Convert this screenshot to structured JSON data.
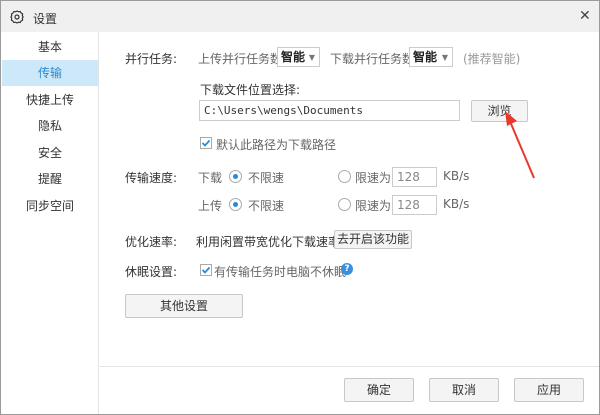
{
  "window": {
    "title": "设置",
    "close": "✕"
  },
  "sidebar": {
    "items": [
      {
        "label": "基本"
      },
      {
        "label": "传输",
        "active": true
      },
      {
        "label": "快捷上传"
      },
      {
        "label": "隐私"
      },
      {
        "label": "安全"
      },
      {
        "label": "提醒"
      },
      {
        "label": "同步空间"
      }
    ]
  },
  "parallel": {
    "label": "并行任务:",
    "upload_label": "上传并行任务数",
    "upload_value": "智能",
    "download_label": "下载并行任务数",
    "download_value": "智能",
    "hint": "(推荐智能)"
  },
  "download_path": {
    "label": "下载文件位置选择:",
    "value": "C:\\Users\\wengs\\Documents",
    "browse": "浏览",
    "default_checkbox": "默认此路径为下载路径",
    "default_checked": true
  },
  "speed": {
    "label": "传输速度:",
    "download_label": "下载",
    "upload_label": "上传",
    "unlimited": "不限速",
    "limit": "限速为",
    "download_limit": "128",
    "upload_limit": "128",
    "unit": "KB/s"
  },
  "optimize": {
    "label": "优化速率:",
    "text": "利用闲置带宽优化下载速率",
    "button": "去开启该功能"
  },
  "sleep": {
    "label": "休眠设置:",
    "checkbox": "有传输任务时电脑不休眠",
    "checked": true,
    "help": "?"
  },
  "other_button": "其他设置",
  "footer": {
    "ok": "确定",
    "cancel": "取消",
    "apply": "应用"
  },
  "colors": {
    "accent": "#2a8ad4",
    "active_bg": "#cde8f8",
    "arrow": "#e8392b"
  }
}
